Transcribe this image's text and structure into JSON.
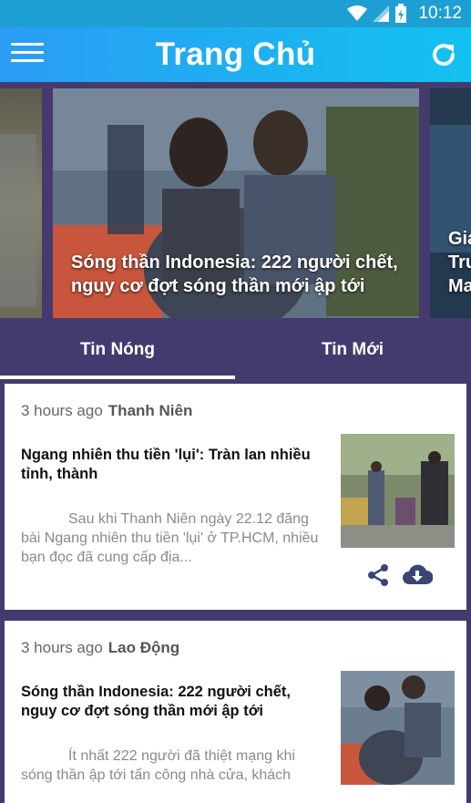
{
  "status_bar": {
    "time": "10:12"
  },
  "app_bar": {
    "title": "Trang Chủ"
  },
  "carousel": {
    "slides": [
      {
        "caption": ""
      },
      {
        "caption": "Sóng thần Indonesia: 222 người chết, nguy cơ đợt sóng thần mới ập tới"
      },
      {
        "caption": "Giá\nTrư\nMa"
      }
    ]
  },
  "tabs": [
    {
      "label": "Tin Nóng",
      "active": true
    },
    {
      "label": "Tin Mới",
      "active": false
    }
  ],
  "articles": [
    {
      "time": "3 hours ago",
      "source": "Thanh Niên",
      "title": "Ngang nhiên thu tiền 'lụi': Tràn lan nhiều tỉnh, thành",
      "summary": "Sau khi Thanh Niên ngày 22.12 đăng bài Ngang nhiên thu tiền 'lụi' ở TP.HCM, nhiều bạn đọc đã cung cấp địa..."
    },
    {
      "time": "3 hours ago",
      "source": "Lao Động",
      "title": "Sóng thần Indonesia: 222 người chết, nguy cơ đợt sóng thần mới ập tới",
      "summary": "Ít nhất 222 người đã thiệt mạng khi sóng thần ập tới tấn công nhà cửa, khách"
    }
  ],
  "icons": {
    "menu": "hamburger-menu-icon",
    "refresh": "refresh-icon",
    "share": "share-icon",
    "download": "cloud-download-icon"
  },
  "colors": {
    "appbar_start": "#2b9cf4",
    "appbar_end": "#12c1ef",
    "background": "#453a6e",
    "icon_accent": "#3a4573"
  }
}
